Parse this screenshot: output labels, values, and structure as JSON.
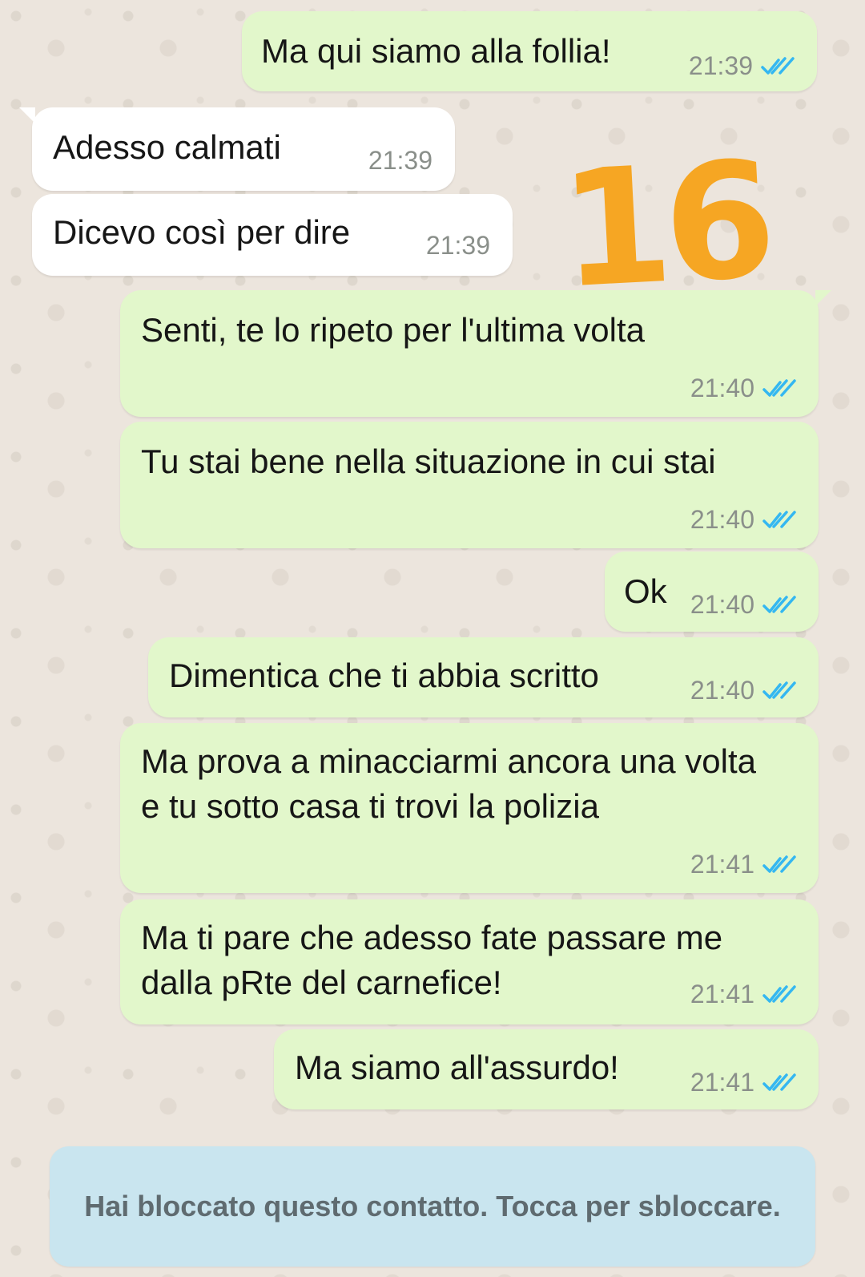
{
  "colors": {
    "outgoing_bubble": "#e2f7cb",
    "incoming_bubble": "#ffffff",
    "read_check": "#34b7f1",
    "annotation": "#f6a623",
    "blocked_banner": "#c9e5ef"
  },
  "annotation": {
    "text": "16"
  },
  "messages": [
    {
      "direction": "outgoing",
      "text": "Ma qui siamo alla follia!",
      "time": "21:39",
      "status_icon": "double-check-read-icon"
    },
    {
      "direction": "incoming",
      "text": "Adesso calmati",
      "time": "21:39"
    },
    {
      "direction": "incoming",
      "text": "Dicevo così per dire",
      "time": "21:39"
    },
    {
      "direction": "outgoing",
      "text": "Senti, te lo ripeto per l'ultima volta",
      "time": "21:40",
      "status_icon": "double-check-read-icon"
    },
    {
      "direction": "outgoing",
      "text": "Tu stai bene nella situazione in cui stai",
      "time": "21:40",
      "status_icon": "double-check-read-icon"
    },
    {
      "direction": "outgoing",
      "text": "Ok",
      "time": "21:40",
      "status_icon": "double-check-read-icon"
    },
    {
      "direction": "outgoing",
      "text": "Dimentica che ti abbia scritto",
      "time": "21:40",
      "status_icon": "double-check-read-icon"
    },
    {
      "direction": "outgoing",
      "text": "Ma prova a minacciarmi ancora una volta e tu sotto casa ti trovi la polizia",
      "time": "21:41",
      "status_icon": "double-check-read-icon"
    },
    {
      "direction": "outgoing",
      "text": "Ma ti pare che adesso fate passare me dalla pRte del carnefice!",
      "time": "21:41",
      "status_icon": "double-check-read-icon"
    },
    {
      "direction": "outgoing",
      "text": "Ma siamo all'assurdo!",
      "time": "21:41",
      "status_icon": "double-check-read-icon"
    }
  ],
  "blocked_banner": {
    "text": "Hai bloccato questo contatto. Tocca per sbloccare."
  }
}
